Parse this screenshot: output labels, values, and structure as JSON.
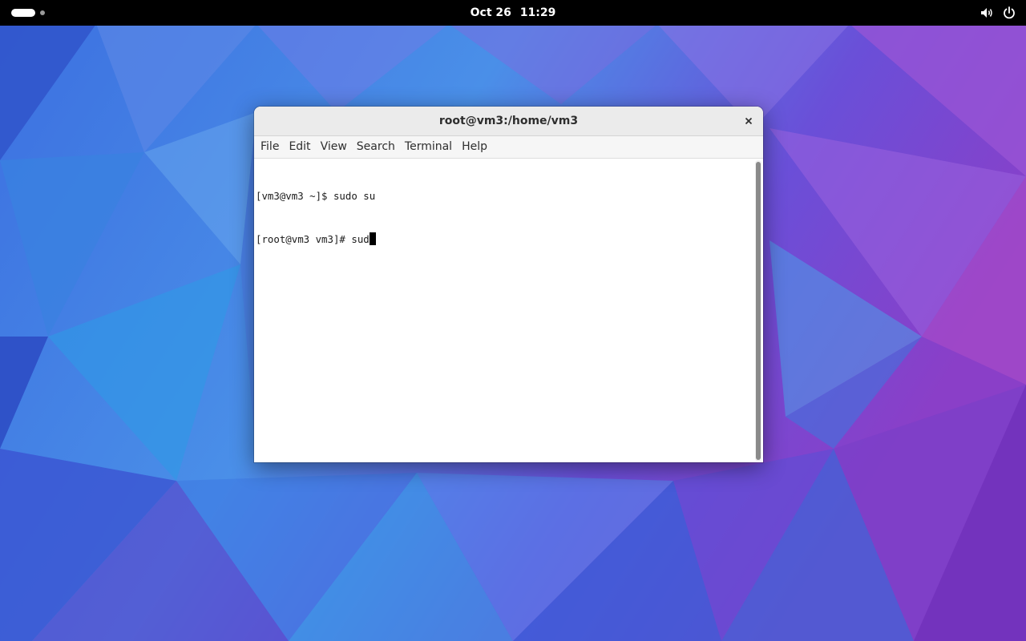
{
  "topbar": {
    "clock_date": "Oct 26",
    "clock_time": "11:29",
    "tray_icons": [
      "volume-icon",
      "power-icon"
    ]
  },
  "window": {
    "title": "root@vm3:/home/vm3",
    "menu": [
      "File",
      "Edit",
      "View",
      "Search",
      "Terminal",
      "Help"
    ],
    "terminal_lines": [
      "[vm3@vm3 ~]$ sudo su",
      "[root@vm3 vm3]# sud"
    ]
  },
  "colors": {
    "topbar_bg": "#000000",
    "titlebar_bg": "#ebebeb",
    "terminal_bg": "#ffffff",
    "terminal_fg": "#1a1a1a"
  }
}
